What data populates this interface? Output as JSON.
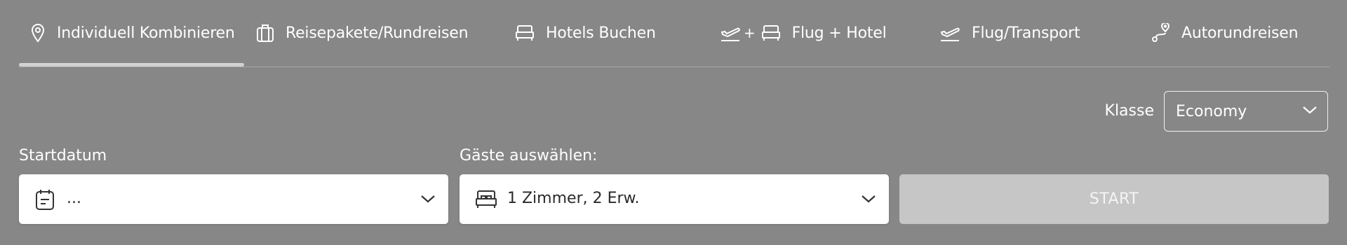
{
  "tabs": [
    {
      "label": "Individuell Kombinieren",
      "icon": "location-pin-icon",
      "active": true
    },
    {
      "label": "Reisepakete/Rundreisen",
      "icon": "suitcase-icon",
      "active": false
    },
    {
      "label": "Hotels Buchen",
      "icon": "bed-icon",
      "active": false
    },
    {
      "label": "Flug + Hotel",
      "icon": "plane-plus-bed-icon",
      "plus": "+",
      "active": false
    },
    {
      "label": "Flug/Transport",
      "icon": "plane-takeoff-icon",
      "active": false
    },
    {
      "label": "Autorundreisen",
      "icon": "route-icon",
      "active": false
    }
  ],
  "klasse": {
    "label": "Klasse",
    "value": "Economy"
  },
  "startdatum": {
    "label": "Startdatum",
    "value": "...",
    "icon": "calendar-icon"
  },
  "gaeste": {
    "label": "Gäste auswählen:",
    "value": "1 Zimmer, 2 Erw.",
    "icon": "bed-icon"
  },
  "start_button": {
    "label": "START"
  },
  "colors": {
    "background": "#878787",
    "field_bg": "#ffffff",
    "button_disabled": "#c6c6c6",
    "active_underline": "#d2d2d2"
  }
}
